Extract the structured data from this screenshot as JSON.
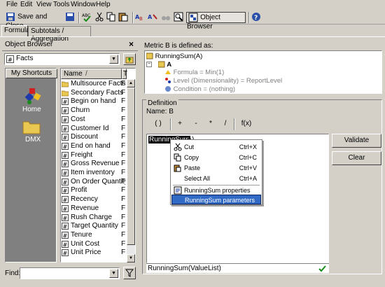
{
  "menu": [
    "File",
    "Edit",
    "View",
    "Tools",
    "Window",
    "Help"
  ],
  "toolbar": {
    "save_close": "Save and Close",
    "object_browser": "Object Browser"
  },
  "tabs": [
    "Formula",
    "Subtotals / Aggregation"
  ],
  "object_browser": {
    "title": "Object Browser",
    "close": "×",
    "combo_value": "Facts",
    "shortcuts_header": "My Shortcuts",
    "shortcuts": [
      "Home",
      "DMX"
    ],
    "col_name": "Name",
    "col_sort": "/",
    "col_type": "T",
    "items": [
      {
        "name": "Multisource Facts",
        "type": "F",
        "icon": "folder"
      },
      {
        "name": "Secondary Facts",
        "type": "F",
        "icon": "folder"
      },
      {
        "name": "Begin on hand",
        "type": "F",
        "icon": "fact"
      },
      {
        "name": "Churn",
        "type": "F",
        "icon": "fact"
      },
      {
        "name": "Cost",
        "type": "F",
        "icon": "fact"
      },
      {
        "name": "Customer Id",
        "type": "F",
        "icon": "fact"
      },
      {
        "name": "Discount",
        "type": "F",
        "icon": "fact"
      },
      {
        "name": "End on hand",
        "type": "F",
        "icon": "fact"
      },
      {
        "name": "Freight",
        "type": "F",
        "icon": "fact"
      },
      {
        "name": "Gross Revenue",
        "type": "F",
        "icon": "fact"
      },
      {
        "name": "Item inventory",
        "type": "F",
        "icon": "fact"
      },
      {
        "name": "On Order Quantity",
        "type": "F",
        "icon": "fact"
      },
      {
        "name": "Profit",
        "type": "F",
        "icon": "fact"
      },
      {
        "name": "Recency",
        "type": "F",
        "icon": "fact"
      },
      {
        "name": "Revenue",
        "type": "F",
        "icon": "fact"
      },
      {
        "name": "Rush Charge",
        "type": "F",
        "icon": "fact"
      },
      {
        "name": "Target Quantity",
        "type": "F",
        "icon": "fact"
      },
      {
        "name": "Tenure",
        "type": "F",
        "icon": "fact"
      },
      {
        "name": "Unit Cost",
        "type": "F",
        "icon": "fact"
      },
      {
        "name": "Unit Price",
        "type": "F",
        "icon": "fact"
      }
    ],
    "find_label": "Find:",
    "find_value": ""
  },
  "metric": {
    "label": "Metric  B  is defined as:",
    "root": "RunningSum(A)",
    "child": "A",
    "props": [
      "Formula = Min(1)",
      "Level (Dimensionality) = ReportLevel",
      "Condition = (nothing)"
    ]
  },
  "definition": {
    "group_label": "Definition",
    "name_label": "Name:  B",
    "operators": [
      "( )",
      "+",
      "-",
      "*",
      "/",
      "f(x)"
    ],
    "editor_text": "RunningSum",
    "editor_suffix": "(A)",
    "status_text": "RunningSum(ValueList)"
  },
  "buttons": {
    "validate": "Validate",
    "clear": "Clear"
  },
  "context_menu": {
    "items": [
      {
        "label": "Cut",
        "shortcut": "Ctrl+X",
        "icon": "scissors",
        "disabled": false
      },
      {
        "label": "Copy",
        "shortcut": "Ctrl+C",
        "icon": "copy",
        "disabled": false
      },
      {
        "label": "Paste",
        "shortcut": "Ctrl+V",
        "icon": "paste",
        "disabled": false
      },
      {
        "label": "Select All",
        "shortcut": "Ctrl+A",
        "icon": "",
        "disabled": false
      },
      {
        "label": "RunningSum properties",
        "shortcut": "",
        "icon": "properties",
        "disabled": false
      },
      {
        "label": "RunningSum parameters",
        "shortcut": "",
        "icon": "",
        "disabled": false
      }
    ]
  },
  "colors": {
    "selection": "#316ac5",
    "chrome": "#d4d0c8"
  }
}
